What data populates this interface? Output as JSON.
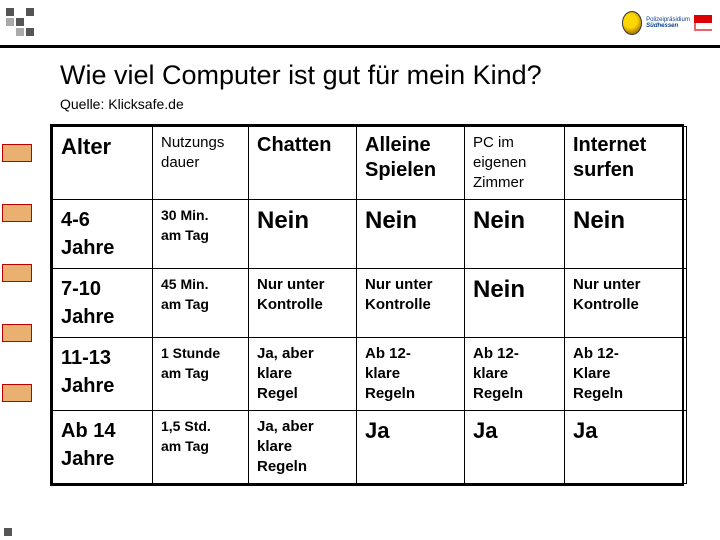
{
  "header": {
    "title": "Wie viel Computer ist gut für mein Kind?",
    "subtitle": "Quelle: Klicksafe.de",
    "logo_brand_top": "Polizeipräsidium",
    "logo_brand_bottom": "Südhessen"
  },
  "table": {
    "headers": {
      "age": "Alter",
      "usage": "Nutzungs\ndauer",
      "chat": "Chatten",
      "play_alone": "Alleine\nSpielen",
      "own_room": "PC im\neigenen\nZimmer",
      "surf": "Internet\nsurfen"
    },
    "rows": [
      {
        "age": "4-6\nJahre",
        "usage": "30 Min.\nam Tag",
        "chat": "Nein",
        "play_alone": "Nein",
        "own_room": "Nein",
        "surf": "Nein"
      },
      {
        "age": "7-10\nJahre",
        "usage": "45 Min.\nam Tag",
        "chat": "Nur unter\nKontrolle",
        "play_alone": "Nur unter\nKontrolle",
        "own_room": "Nein",
        "surf": "Nur unter\nKontrolle"
      },
      {
        "age": "11-13\nJahre",
        "usage": "1 Stunde\nam Tag",
        "chat": "Ja, aber\nklare\nRegel",
        "play_alone": "Ab 12-\nklare\nRegeln",
        "own_room": "Ab 12-\nklare\nRegeln",
        "surf": "Ab 12-\nKlare\nRegeln"
      },
      {
        "age": "Ab 14\nJahre",
        "usage": "1,5 Std.\nam Tag",
        "chat": "Ja, aber\nklare\nRegeln",
        "play_alone": "Ja",
        "own_room": "Ja",
        "surf": "Ja"
      }
    ]
  }
}
